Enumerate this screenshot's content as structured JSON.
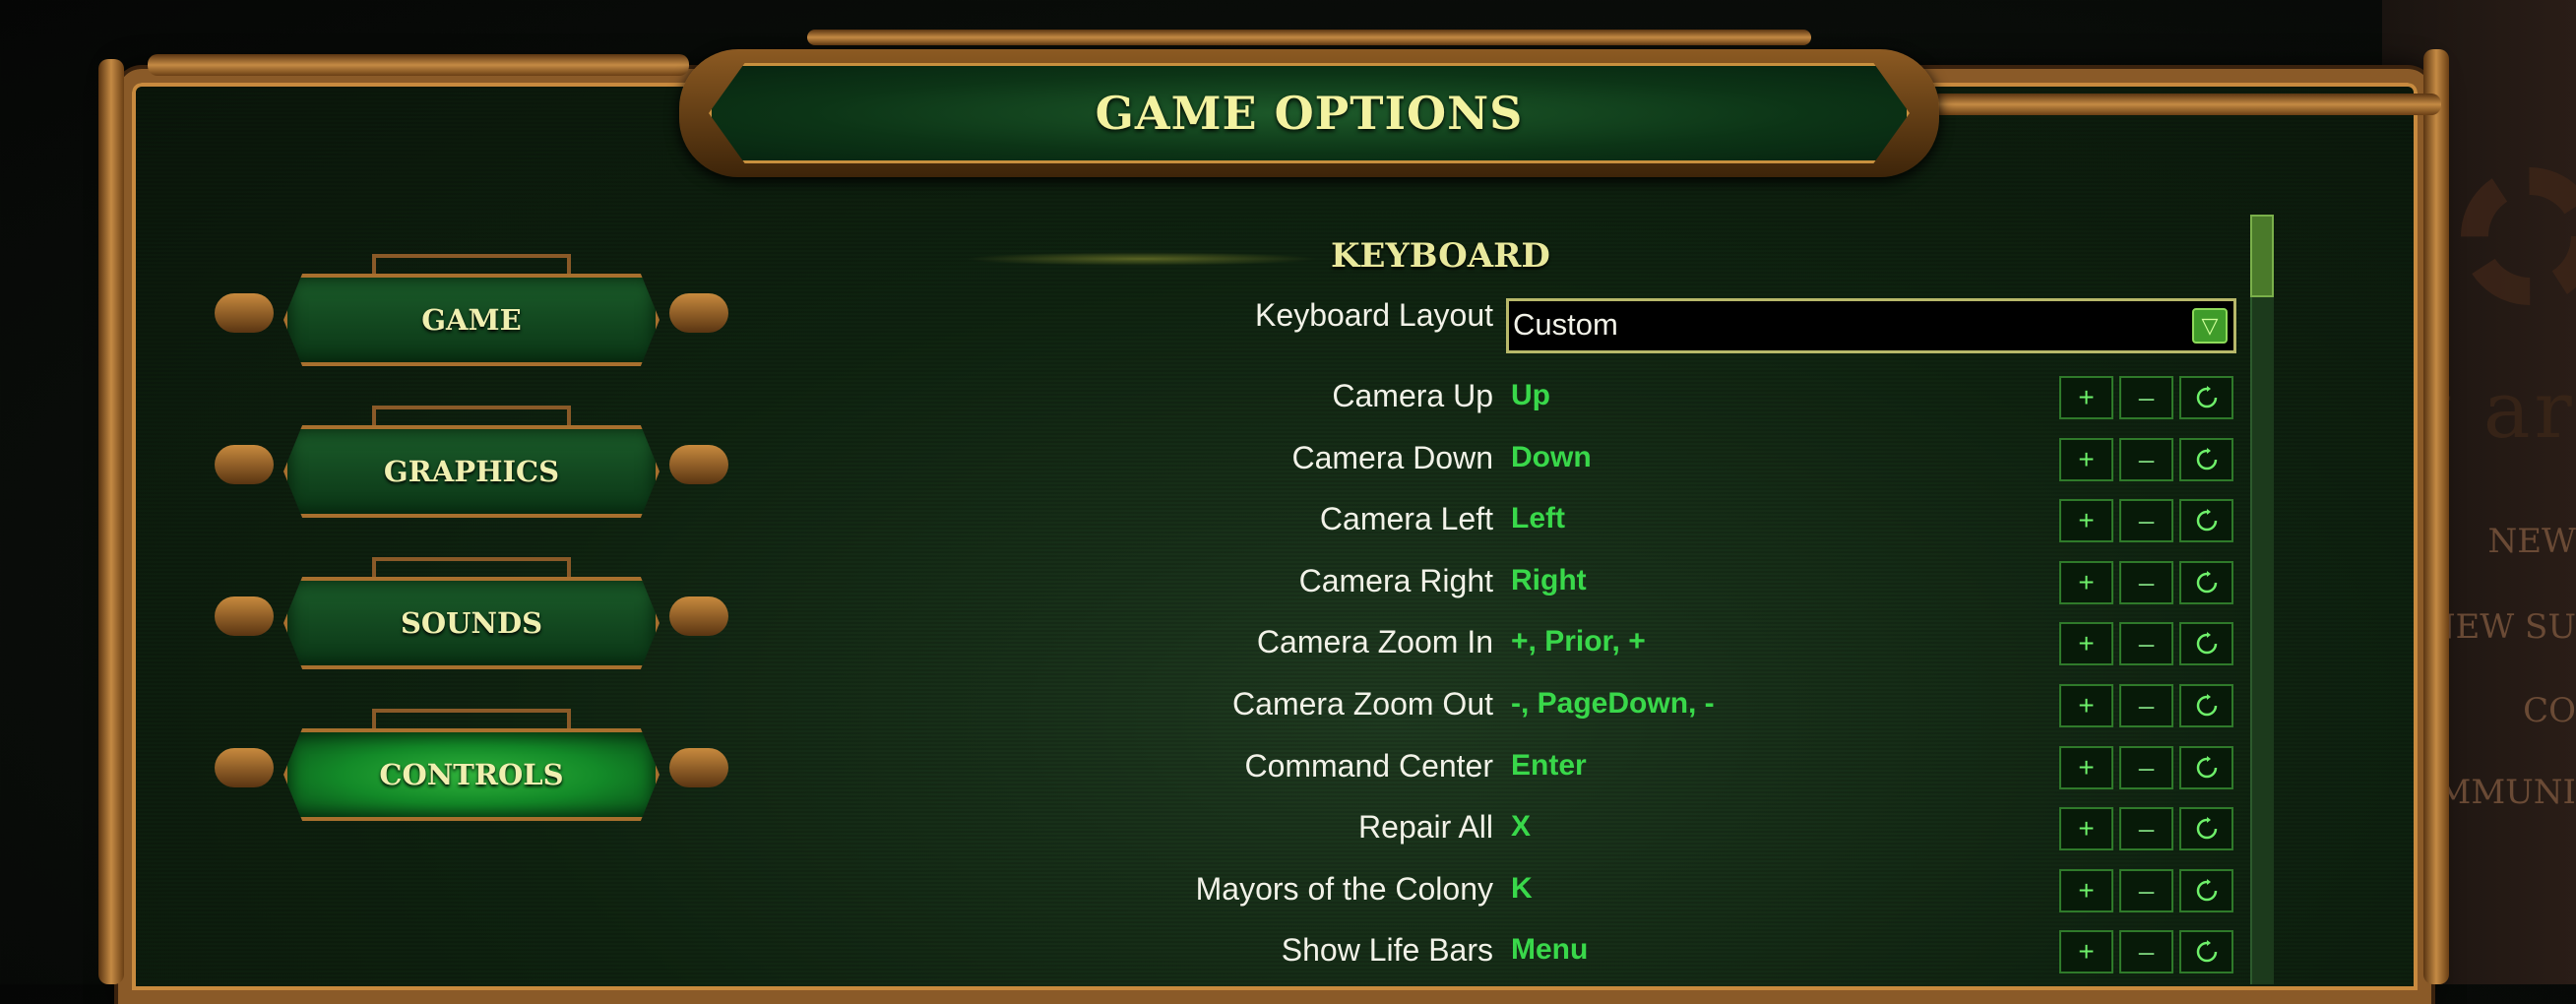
{
  "background": {
    "logo_text": "They are",
    "menu_items": [
      "NEW",
      "NEW SU",
      "CO",
      "OMMUNI"
    ]
  },
  "header": {
    "title": "GAME OPTIONS"
  },
  "sidebar": {
    "items": [
      {
        "label": "GAME",
        "active": false
      },
      {
        "label": "GRAPHICS",
        "active": false
      },
      {
        "label": "SOUNDS",
        "active": false
      },
      {
        "label": "CONTROLS",
        "active": true
      }
    ]
  },
  "keyboard": {
    "section_title": "KEYBOARD",
    "layout_label": "Keyboard Layout",
    "layout_value": "Custom",
    "button_labels": {
      "add": "+",
      "remove": "–"
    },
    "bindings": [
      {
        "label": "Camera Up",
        "value": "Up"
      },
      {
        "label": "Camera Down",
        "value": "Down"
      },
      {
        "label": "Camera Left",
        "value": "Left"
      },
      {
        "label": "Camera Right",
        "value": "Right"
      },
      {
        "label": "Camera Zoom In",
        "value": "+, Prior, +"
      },
      {
        "label": "Camera Zoom Out",
        "value": "-, PageDown, -"
      },
      {
        "label": "Command Center",
        "value": "Enter"
      },
      {
        "label": "Repair All",
        "value": "X"
      },
      {
        "label": "Mayors of the Colony",
        "value": "K"
      },
      {
        "label": "Show Life Bars",
        "value": "Menu"
      }
    ]
  },
  "colors": {
    "binding_value": "#39d84a",
    "title_text": "#f3f2a0",
    "frame_brass": "#8a5a28"
  },
  "icons": {
    "dropdown": "triangle-down-icon",
    "reset": "reset-icon"
  }
}
